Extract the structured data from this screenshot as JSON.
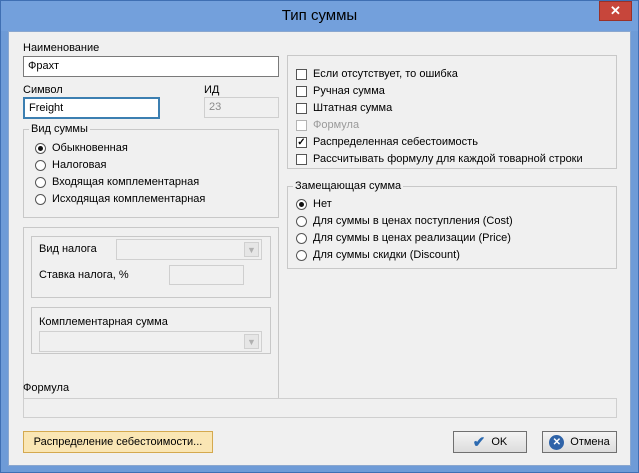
{
  "window": {
    "title": "Тип суммы",
    "close_glyph": "✕"
  },
  "name_field": {
    "label": "Наименование",
    "value": "Фрахт"
  },
  "symbol_field": {
    "label": "Символ",
    "value": "Freight"
  },
  "id_field": {
    "label": "ИД",
    "value": "23"
  },
  "sum_type_group": {
    "title": "Вид суммы",
    "options": [
      {
        "label": "Обыкновенная",
        "selected": true
      },
      {
        "label": "Налоговая",
        "selected": false
      },
      {
        "label": "Входящая комплементарная",
        "selected": false
      },
      {
        "label": "Исходящая комплементарная",
        "selected": false
      }
    ]
  },
  "tax": {
    "type_label": "Вид налога",
    "rate_label": "Ставка налога, %"
  },
  "complementary": {
    "label": "Комплементарная сумма"
  },
  "flags": [
    {
      "label": "Если отсутствует, то ошибка",
      "checked": false,
      "disabled": false
    },
    {
      "label": "Ручная сумма",
      "checked": false,
      "disabled": false
    },
    {
      "label": "Штатная сумма",
      "checked": false,
      "disabled": false
    },
    {
      "label": "Формула",
      "checked": false,
      "disabled": true
    },
    {
      "label": "Распределенная себестоимость",
      "checked": true,
      "disabled": false
    },
    {
      "label": "Рассчитывать формулу для каждой товарной строки",
      "checked": false,
      "disabled": false
    }
  ],
  "replacement_group": {
    "title": "Замещающая сумма",
    "options": [
      {
        "label": "Нет",
        "selected": true
      },
      {
        "label": "Для суммы в ценах поступления (Cost)",
        "selected": false
      },
      {
        "label": "Для суммы в ценах реализации (Price)",
        "selected": false
      },
      {
        "label": "Для суммы скидки (Discount)",
        "selected": false
      }
    ]
  },
  "formula": {
    "label": "Формула",
    "value": ""
  },
  "buttons": {
    "distribution": "Распределение себестоимости...",
    "ok": "OK",
    "cancel": "Отмена"
  },
  "icons": {
    "ok": "check-icon",
    "cancel": "cancel-icon",
    "combo_arrow": "chevron-down-icon"
  },
  "colors": {
    "titlebar": "#73a0dc",
    "close": "#c7463b",
    "focus": "#3c7fb1",
    "hot_button": "#fae6b4"
  }
}
